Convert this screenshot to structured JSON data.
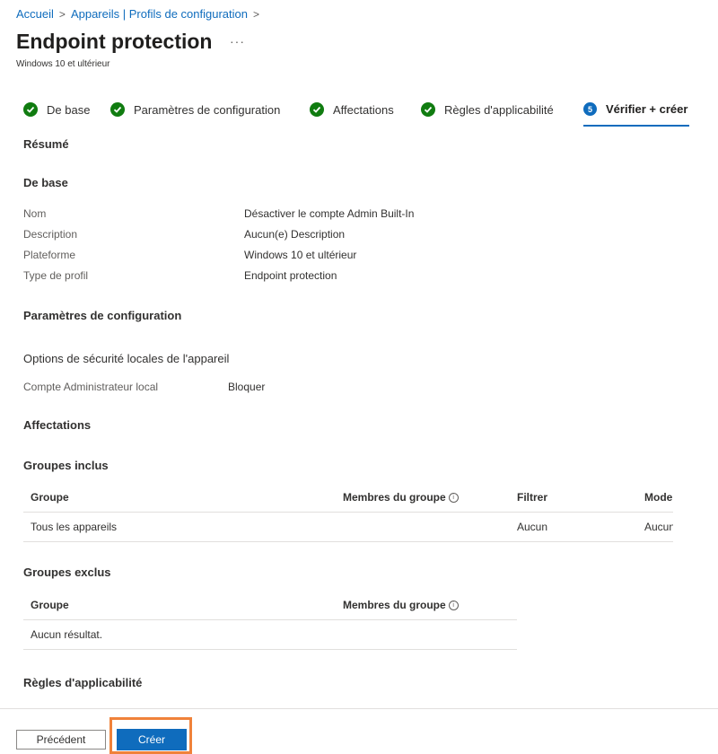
{
  "breadcrumb": {
    "home": "Accueil",
    "section": "Appareils | Profils de configuration",
    "separator": ">"
  },
  "page": {
    "title": "Endpoint protection",
    "more_label": "···",
    "subtitle": "Windows 10 et ultérieur"
  },
  "steps": [
    {
      "label": "De base",
      "state": "done"
    },
    {
      "label": "Paramètres de configuration",
      "state": "done"
    },
    {
      "label": "Affectations",
      "state": "done"
    },
    {
      "label": "Règles d'applicabilité",
      "state": "done"
    },
    {
      "label": "Vérifier + créer",
      "state": "current",
      "number": "5"
    }
  ],
  "summary": {
    "heading": "Résumé",
    "basics": {
      "heading": "De base",
      "rows": [
        {
          "label": "Nom",
          "value": "Désactiver le compte Admin Built-In"
        },
        {
          "label": "Description",
          "value": "Aucun(e) Description"
        },
        {
          "label": "Plateforme",
          "value": "Windows 10 et ultérieur"
        },
        {
          "label": "Type de profil",
          "value": "Endpoint protection"
        }
      ]
    },
    "config": {
      "heading": "Paramètres de configuration",
      "subheading": "Options de sécurité locales de l'appareil",
      "setting_label": "Compte Administrateur local",
      "setting_value": "Bloquer"
    },
    "assignments": {
      "heading": "Affectations",
      "included": {
        "heading": "Groupes inclus",
        "columns": [
          "Groupe",
          "Membres du groupe",
          "Filtrer",
          "Mode"
        ],
        "rows": [
          {
            "group": "Tous les appareils",
            "members": "",
            "filter": "Aucun",
            "mode": "Aucun"
          }
        ]
      },
      "excluded": {
        "heading": "Groupes exclus",
        "columns": [
          "Groupe",
          "Membres du groupe"
        ],
        "empty_text": "Aucun résultat."
      }
    },
    "applicability": {
      "heading": "Règles d'applicabilité"
    }
  },
  "footer": {
    "previous_label": "Précédent",
    "create_label": "Créer"
  },
  "colors": {
    "accent": "#0f6cbd",
    "success": "#107c10",
    "highlight": "#f0823a"
  }
}
